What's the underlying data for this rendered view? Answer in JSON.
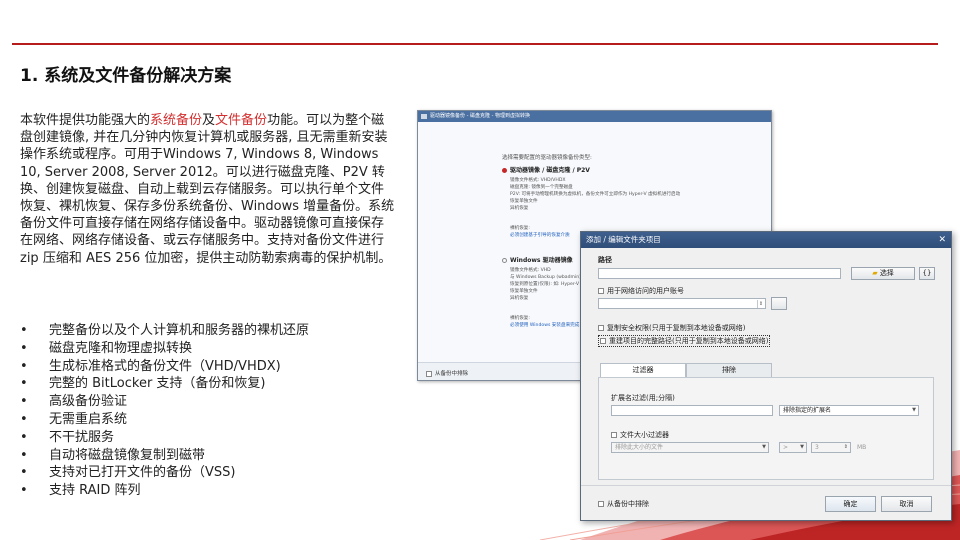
{
  "slide": {
    "title": "1. 系统及文件备份解决方案",
    "intro": {
      "part1": "本软件提供功能强大的",
      "highlight1": "系统备份",
      "part2": "及",
      "highlight2": "文件备份",
      "part3": "功能。可以为整个磁盘创建镜像, 并在几分钟内恢复计算机或服务器, 且无需重新安装操作系统或程序。可用于Windows 7, Windows 8, Windows 10, Server 2008, Server 2012。可以进行磁盘克隆、P2V 转换、创建恢复磁盘、自动上载到云存储服务。可以执行单个文件恢复、裸机恢复、保存多份系统备份、Windows 增量备份。系统备份文件可直接存储在网络存储设备中。驱动器镜像可直接保存在网络、网络存储设备、或云存储服务中。支持对备份文件进行 zip 压缩和 AES 256 位加密，提供主动防勒索病毒的保护机制。"
    },
    "bullets": [
      "完整备份以及个人计算机和服务器的裸机还原",
      "磁盘克隆和物理虚拟转换",
      "生成标准格式的备份文件（VHD/VHDX)",
      "完整的 BitLocker 支持（备份和恢复)",
      "高级备份验证",
      "无需重启系统",
      "不干扰服务",
      "自动将磁盘镜像复制到磁带",
      "支持对已打开文件的备份（VSS)",
      "支持 RAID 阵列"
    ],
    "accent_color": "#c62828"
  },
  "wizard": {
    "title": "驱动器镜像备份 - 磁盘克隆 - 物理到虚拟转换",
    "prompt": "选择需要配置的驱动器镜像备份类型:",
    "option1": {
      "label": "驱动器镜像 / 磁盘克隆 / P2V",
      "lines": [
        "镜像文件格式: VHD/VHDX",
        "磁盘克隆: 镜像到一个完整磁盘",
        "P2V: 可将手动物理机转换为虚拟机，备份文件可立即作为 Hyper-V 虚拟机进行启动",
        "恢复单独文件",
        "异机恢复"
      ],
      "recover_label": "裸机恢复:",
      "recover_link": "必须创建基于引导的恢复介质"
    },
    "option2": {
      "label": "Windows 驱动器镜像",
      "lines": [
        "镜像文件格式: VHD",
        "与 Windows Backup (wbadmin) 兼容",
        "恢复到原位置(仅限): 如: Hyper-V",
        "恢复单独文件",
        "异机恢复"
      ],
      "recover_label": "裸机恢复:",
      "recover_link": "必须使用 Windows 安装盘来完成"
    },
    "footer_checkbox": "从备份中排除"
  },
  "dialog": {
    "title": "添加 / 编辑文件夹项目",
    "path_label": "路径",
    "path_value": "",
    "browse_button": "选择",
    "braces_button": "{}",
    "network_user_checkbox": "用于网络访问的用户账号",
    "security_checkbox": "复制安全权限(只用于复制到本地设备或网络)",
    "fullpath_checkbox": "重建项目的完整路径(只用于复制到本地设备或网络)",
    "tab_filter": "过滤器",
    "tab_exclude": "排除",
    "ext_filter_label": "扩展名过滤(用;分隔)",
    "ext_filter_value": "",
    "ext_mode": "排除指定的扩展名",
    "size_filter_checkbox": "文件大小过滤器",
    "size_mode": "排除此大小的文件",
    "size_op": ">",
    "size_value": "3",
    "size_unit": "MB",
    "exclude_checkbox": "从备份中排除",
    "ok_button": "确定",
    "cancel_button": "取消"
  }
}
